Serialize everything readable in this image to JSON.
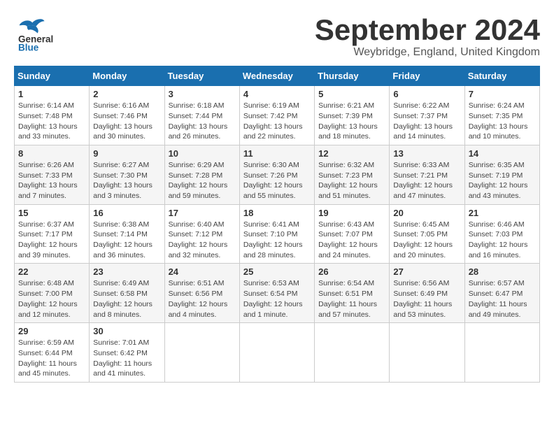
{
  "header": {
    "logo_general": "General",
    "logo_blue": "Blue",
    "month_title": "September 2024",
    "location": "Weybridge, England, United Kingdom"
  },
  "calendar": {
    "days_of_week": [
      "Sunday",
      "Monday",
      "Tuesday",
      "Wednesday",
      "Thursday",
      "Friday",
      "Saturday"
    ],
    "weeks": [
      [
        {
          "day": "1",
          "sunrise": "6:14 AM",
          "sunset": "7:48 PM",
          "daylight": "Daylight: 13 hours and 33 minutes."
        },
        {
          "day": "2",
          "sunrise": "6:16 AM",
          "sunset": "7:46 PM",
          "daylight": "Daylight: 13 hours and 30 minutes."
        },
        {
          "day": "3",
          "sunrise": "6:18 AM",
          "sunset": "7:44 PM",
          "daylight": "Daylight: 13 hours and 26 minutes."
        },
        {
          "day": "4",
          "sunrise": "6:19 AM",
          "sunset": "7:42 PM",
          "daylight": "Daylight: 13 hours and 22 minutes."
        },
        {
          "day": "5",
          "sunrise": "6:21 AM",
          "sunset": "7:39 PM",
          "daylight": "Daylight: 13 hours and 18 minutes."
        },
        {
          "day": "6",
          "sunrise": "6:22 AM",
          "sunset": "7:37 PM",
          "daylight": "Daylight: 13 hours and 14 minutes."
        },
        {
          "day": "7",
          "sunrise": "6:24 AM",
          "sunset": "7:35 PM",
          "daylight": "Daylight: 13 hours and 10 minutes."
        }
      ],
      [
        {
          "day": "8",
          "sunrise": "6:26 AM",
          "sunset": "7:33 PM",
          "daylight": "Daylight: 13 hours and 7 minutes."
        },
        {
          "day": "9",
          "sunrise": "6:27 AM",
          "sunset": "7:30 PM",
          "daylight": "Daylight: 13 hours and 3 minutes."
        },
        {
          "day": "10",
          "sunrise": "6:29 AM",
          "sunset": "7:28 PM",
          "daylight": "Daylight: 12 hours and 59 minutes."
        },
        {
          "day": "11",
          "sunrise": "6:30 AM",
          "sunset": "7:26 PM",
          "daylight": "Daylight: 12 hours and 55 minutes."
        },
        {
          "day": "12",
          "sunrise": "6:32 AM",
          "sunset": "7:23 PM",
          "daylight": "Daylight: 12 hours and 51 minutes."
        },
        {
          "day": "13",
          "sunrise": "6:33 AM",
          "sunset": "7:21 PM",
          "daylight": "Daylight: 12 hours and 47 minutes."
        },
        {
          "day": "14",
          "sunrise": "6:35 AM",
          "sunset": "7:19 PM",
          "daylight": "Daylight: 12 hours and 43 minutes."
        }
      ],
      [
        {
          "day": "15",
          "sunrise": "6:37 AM",
          "sunset": "7:17 PM",
          "daylight": "Daylight: 12 hours and 39 minutes."
        },
        {
          "day": "16",
          "sunrise": "6:38 AM",
          "sunset": "7:14 PM",
          "daylight": "Daylight: 12 hours and 36 minutes."
        },
        {
          "day": "17",
          "sunrise": "6:40 AM",
          "sunset": "7:12 PM",
          "daylight": "Daylight: 12 hours and 32 minutes."
        },
        {
          "day": "18",
          "sunrise": "6:41 AM",
          "sunset": "7:10 PM",
          "daylight": "Daylight: 12 hours and 28 minutes."
        },
        {
          "day": "19",
          "sunrise": "6:43 AM",
          "sunset": "7:07 PM",
          "daylight": "Daylight: 12 hours and 24 minutes."
        },
        {
          "day": "20",
          "sunrise": "6:45 AM",
          "sunset": "7:05 PM",
          "daylight": "Daylight: 12 hours and 20 minutes."
        },
        {
          "day": "21",
          "sunrise": "6:46 AM",
          "sunset": "7:03 PM",
          "daylight": "Daylight: 12 hours and 16 minutes."
        }
      ],
      [
        {
          "day": "22",
          "sunrise": "6:48 AM",
          "sunset": "7:00 PM",
          "daylight": "Daylight: 12 hours and 12 minutes."
        },
        {
          "day": "23",
          "sunrise": "6:49 AM",
          "sunset": "6:58 PM",
          "daylight": "Daylight: 12 hours and 8 minutes."
        },
        {
          "day": "24",
          "sunrise": "6:51 AM",
          "sunset": "6:56 PM",
          "daylight": "Daylight: 12 hours and 4 minutes."
        },
        {
          "day": "25",
          "sunrise": "6:53 AM",
          "sunset": "6:54 PM",
          "daylight": "Daylight: 12 hours and 1 minute."
        },
        {
          "day": "26",
          "sunrise": "6:54 AM",
          "sunset": "6:51 PM",
          "daylight": "Daylight: 11 hours and 57 minutes."
        },
        {
          "day": "27",
          "sunrise": "6:56 AM",
          "sunset": "6:49 PM",
          "daylight": "Daylight: 11 hours and 53 minutes."
        },
        {
          "day": "28",
          "sunrise": "6:57 AM",
          "sunset": "6:47 PM",
          "daylight": "Daylight: 11 hours and 49 minutes."
        }
      ],
      [
        {
          "day": "29",
          "sunrise": "6:59 AM",
          "sunset": "6:44 PM",
          "daylight": "Daylight: 11 hours and 45 minutes."
        },
        {
          "day": "30",
          "sunrise": "7:01 AM",
          "sunset": "6:42 PM",
          "daylight": "Daylight: 11 hours and 41 minutes."
        },
        null,
        null,
        null,
        null,
        null
      ]
    ]
  }
}
